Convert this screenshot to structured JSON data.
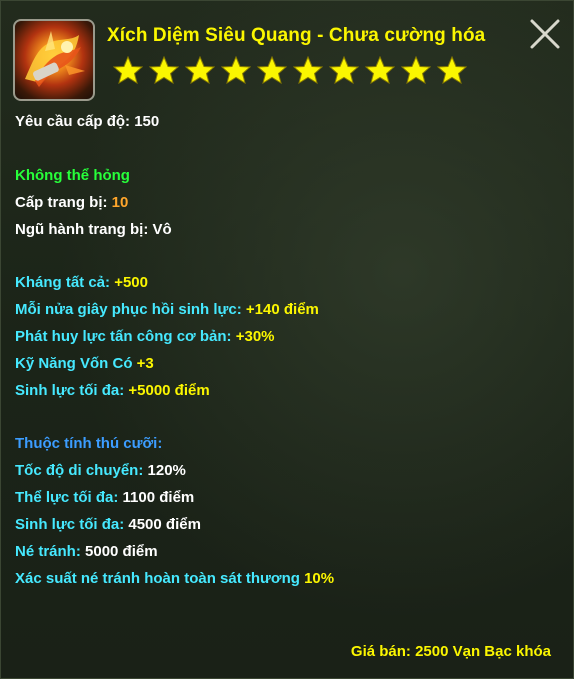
{
  "item": {
    "name": "Xích Diệm Siêu Quang - Chưa cường hóa",
    "icon": "flaming-mount-icon",
    "star_count": 10,
    "level_req_label": "Yêu cầu cấp độ: ",
    "level_req_value": "150"
  },
  "status": {
    "durability": "Không thể hỏng",
    "equip_level_label": "Cấp trang bị: ",
    "equip_level_value": "10",
    "element_label": "Ngũ hành trang bị: ",
    "element_value": "Vô"
  },
  "attributes": [
    {
      "label": "Kháng tất cả: ",
      "value": "+500"
    },
    {
      "label": "Mỗi nửa giây phục hồi sinh lực: ",
      "value": "+140 điểm"
    },
    {
      "label": "Phát huy lực tấn công cơ bản: ",
      "value": "+30%"
    },
    {
      "label": "Kỹ Năng Vốn Có ",
      "value": "+3"
    },
    {
      "label": "Sinh lực tối đa: ",
      "value": "+5000 điểm"
    }
  ],
  "mount": {
    "heading": "Thuộc tính thú cưỡi:",
    "stats": [
      {
        "label": "Tốc độ di chuyển: ",
        "value": "120%"
      },
      {
        "label": "Thể lực tối đa: ",
        "value": "1100 điểm"
      },
      {
        "label": "Sinh lực tối đa: ",
        "value": "4500 điểm"
      },
      {
        "label": "Né tránh: ",
        "value": "5000 điểm"
      },
      {
        "label": "Xác suất né tránh hoàn toàn sát thương ",
        "value": "10%"
      }
    ]
  },
  "price": "Giá bán: 2500 Vạn Bạc khóa",
  "colors": {
    "title": "#fbf600",
    "green": "#27ff3a",
    "cyan": "#46e9ff",
    "blue": "#3c9dff",
    "orange": "#ffa62b"
  }
}
